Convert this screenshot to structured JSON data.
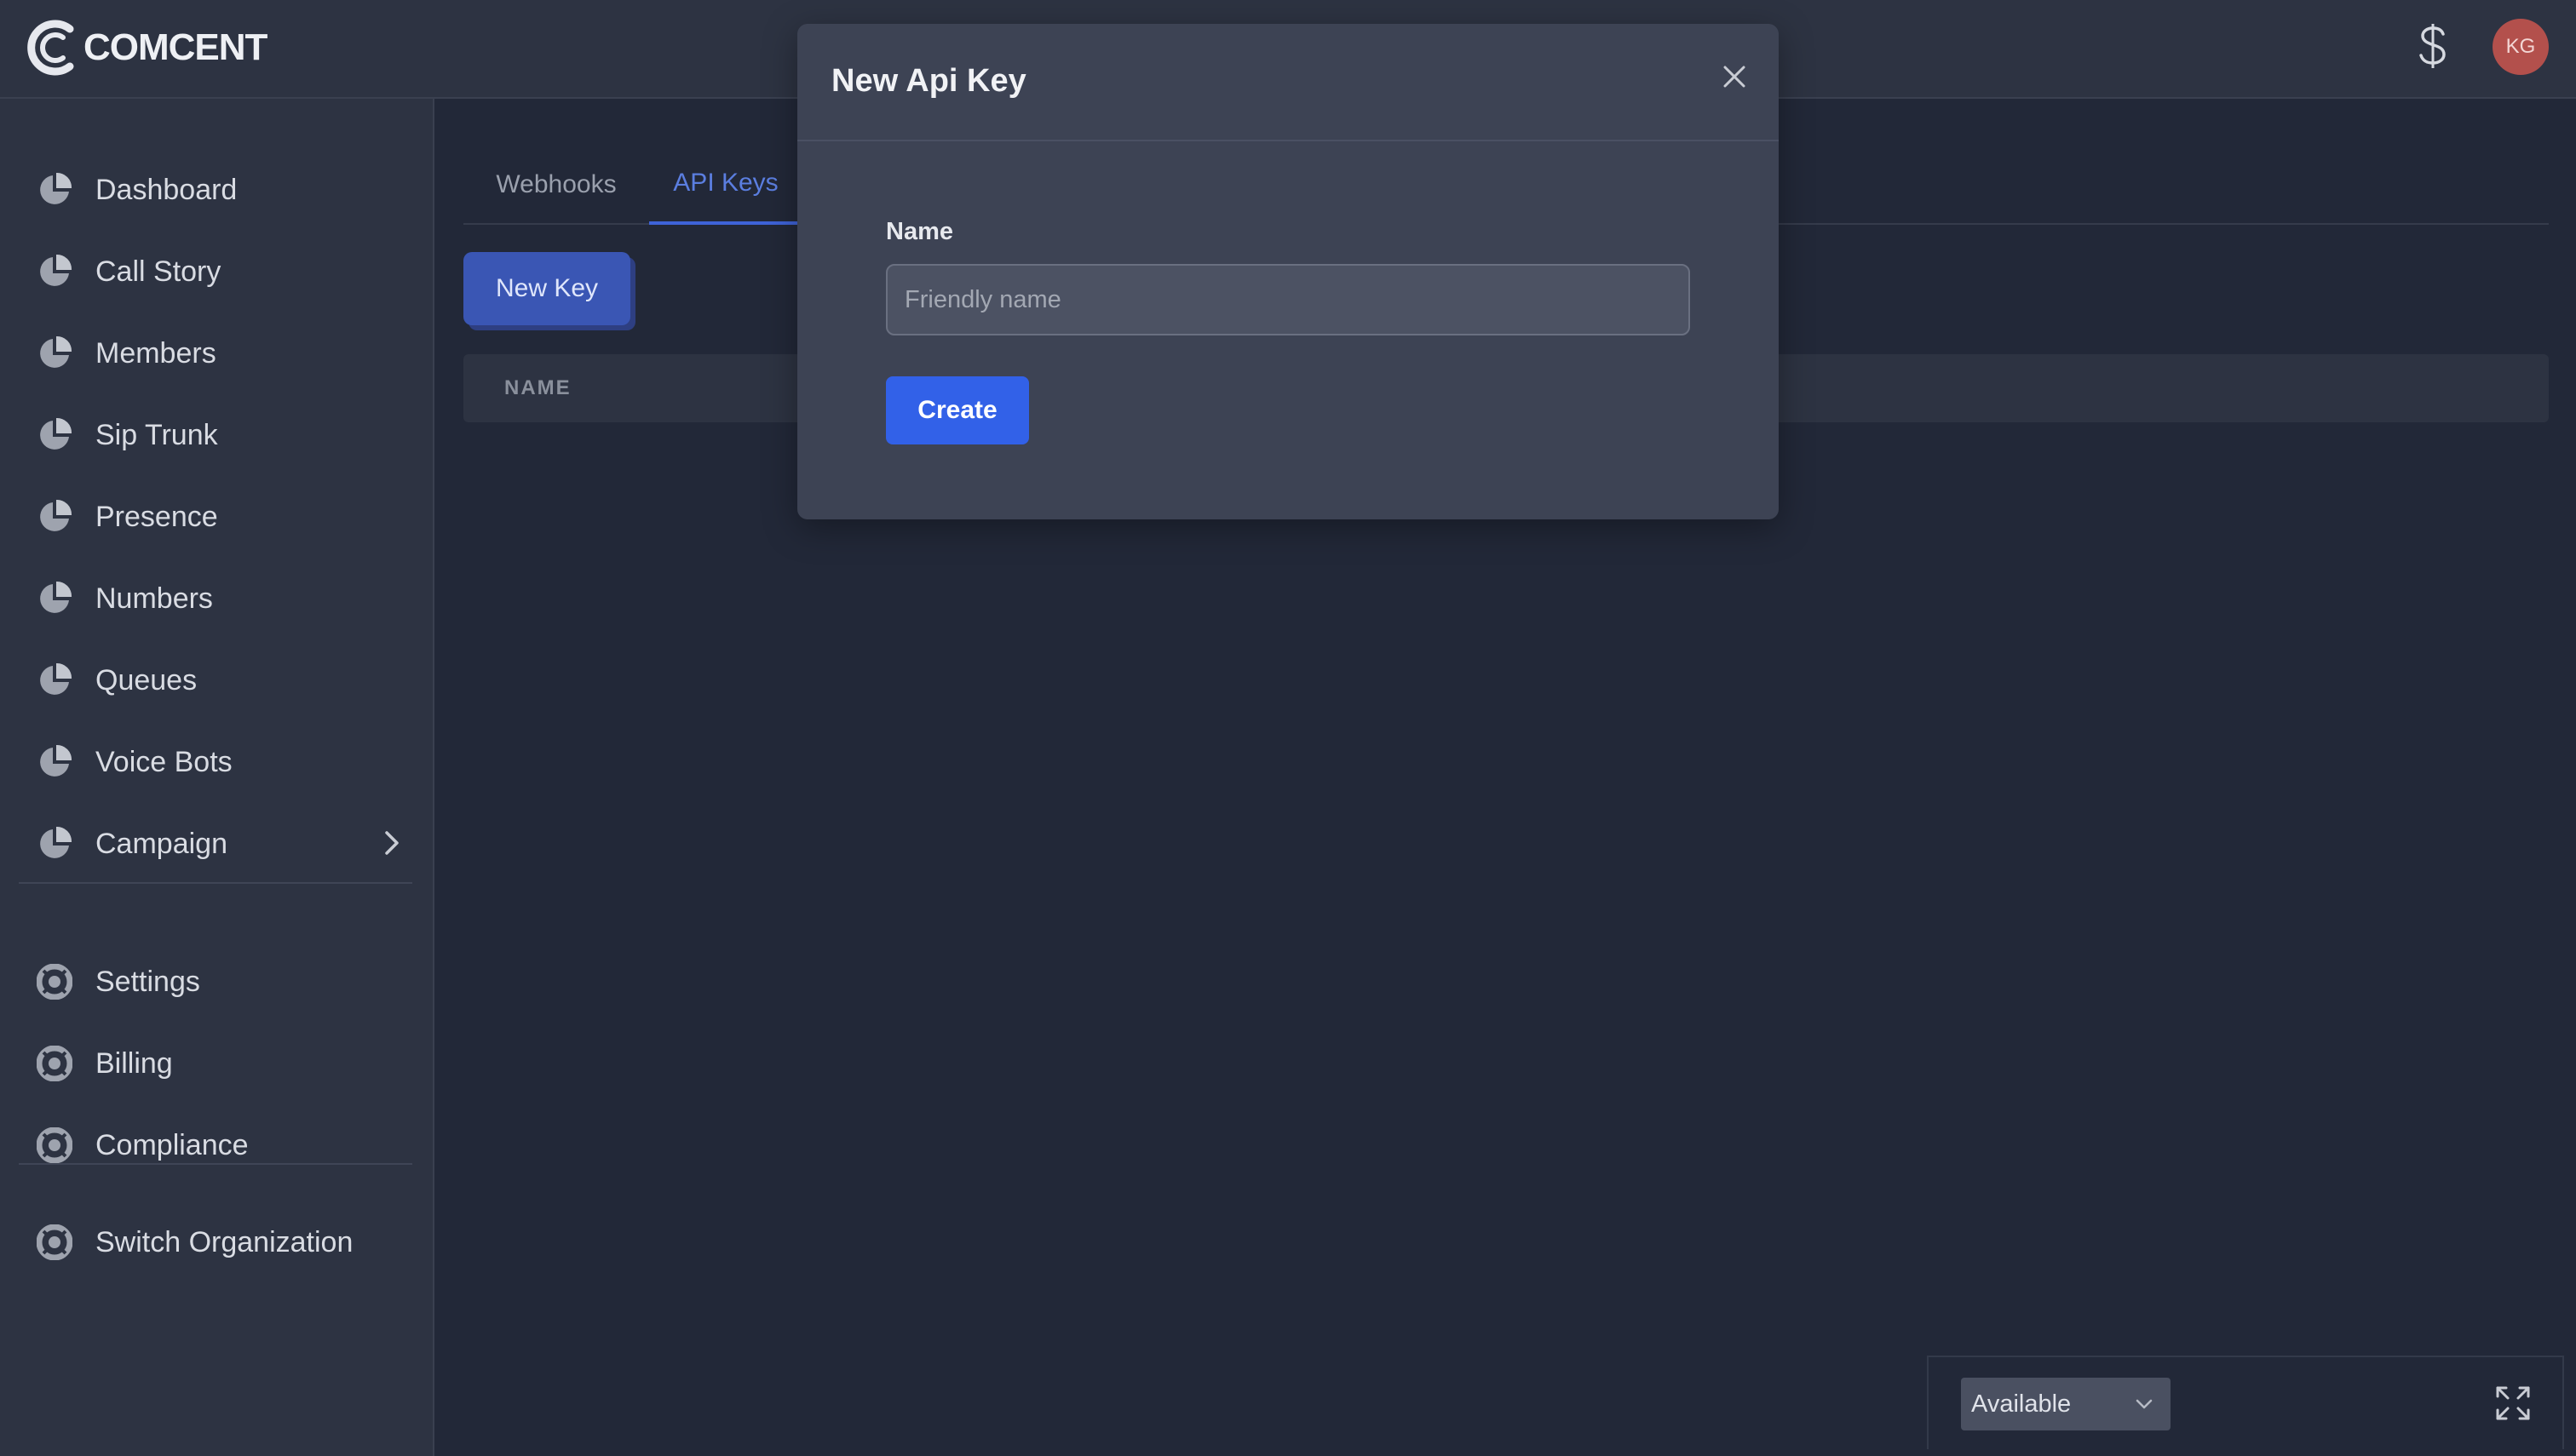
{
  "app": {
    "brand": "COMCENT"
  },
  "header": {
    "currency_symbol": "$",
    "avatar_initials": "KG"
  },
  "sidebar": {
    "primary": [
      {
        "label": "Dashboard",
        "icon": "pie-chart-icon"
      },
      {
        "label": "Call Story",
        "icon": "pie-chart-icon"
      },
      {
        "label": "Members",
        "icon": "pie-chart-icon"
      },
      {
        "label": "Sip Trunk",
        "icon": "pie-chart-icon"
      },
      {
        "label": "Presence",
        "icon": "pie-chart-icon"
      },
      {
        "label": "Numbers",
        "icon": "pie-chart-icon"
      },
      {
        "label": "Queues",
        "icon": "pie-chart-icon"
      },
      {
        "label": "Voice Bots",
        "icon": "pie-chart-icon"
      },
      {
        "label": "Campaign",
        "icon": "pie-chart-icon",
        "has_submenu": true
      }
    ],
    "secondary": [
      {
        "label": "Settings",
        "icon": "lifebuoy-icon"
      },
      {
        "label": "Billing",
        "icon": "lifebuoy-icon"
      },
      {
        "label": "Compliance",
        "icon": "lifebuoy-icon"
      }
    ],
    "footer": [
      {
        "label": "Switch Organization",
        "icon": "lifebuoy-icon"
      }
    ]
  },
  "main": {
    "tabs": [
      {
        "label": "Webhooks",
        "active": false
      },
      {
        "label": "API Keys",
        "active": true
      }
    ],
    "new_key_label": "New Key",
    "table": {
      "columns": [
        "NAME"
      ]
    }
  },
  "modal": {
    "title": "New Api Key",
    "name_label": "Name",
    "name_placeholder": "Friendly name",
    "name_value": "",
    "create_label": "Create"
  },
  "status": {
    "selected": "Available"
  },
  "colors": {
    "accent": "#3261e8",
    "active_tab": "#5b7ee0",
    "avatar_bg": "#b3504c",
    "background": "#222838",
    "surface": "#2d3342",
    "modal": "#3d4354"
  }
}
